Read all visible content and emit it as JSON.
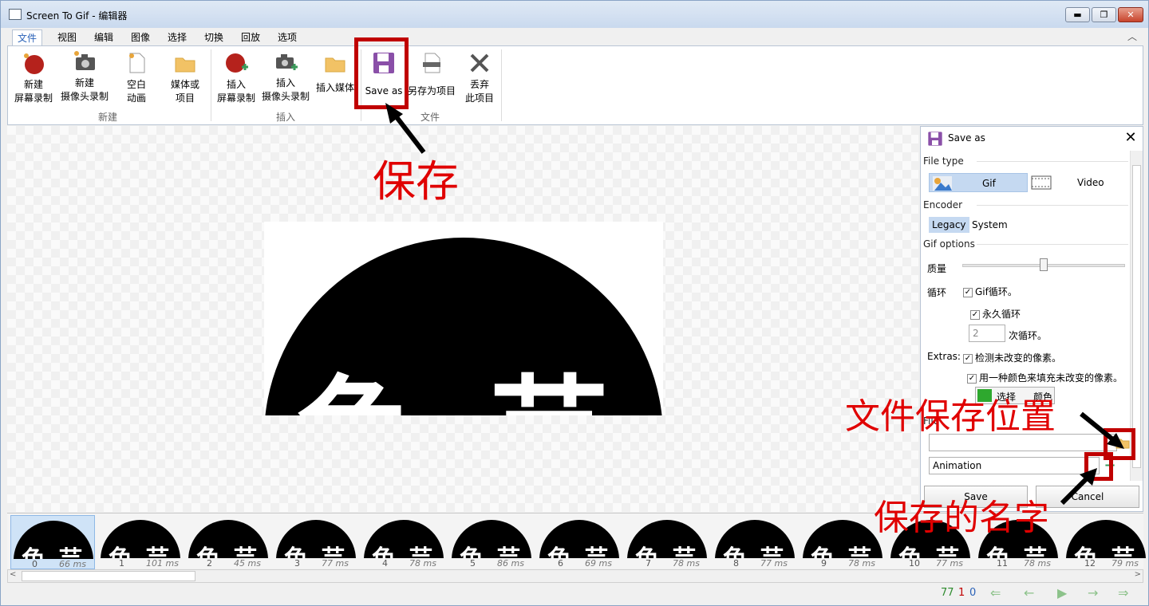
{
  "window": {
    "title": "Screen To Gif - 编辑器",
    "min": "▬",
    "max": "❐",
    "close": "✕"
  },
  "tabs": [
    "文件",
    "视图",
    "编辑",
    "图像",
    "选择",
    "切换",
    "回放",
    "选项"
  ],
  "ribbon": {
    "new_group": "新建",
    "insert_group": "插入",
    "file_group": "文件",
    "new_screen": [
      "新建",
      "屏幕录制"
    ],
    "new_webcam": [
      "新建",
      "摄像头录制"
    ],
    "blank": [
      "空白",
      "动画"
    ],
    "media": [
      "媒体或",
      "项目"
    ],
    "insert_screen": [
      "插入",
      "屏幕录制"
    ],
    "insert_webcam": [
      "插入",
      "摄像头录制"
    ],
    "insert_media": "插入媒体",
    "save_as": "Save as",
    "save_project": "另存为项目",
    "discard": [
      "丢弃",
      "此项目"
    ]
  },
  "canvas": {
    "glyphs": "色 芸"
  },
  "panel": {
    "title": "Save as",
    "file_type": "File type",
    "gif": "Gif",
    "video": "Video",
    "encoder": "Encoder",
    "legacy": "Legacy",
    "system": "System",
    "gif_options": "Gif options",
    "quality": "质量",
    "quality_level": 0.5,
    "loop": "循环",
    "gif_loop": "Gif循环。",
    "forever": "永久循环",
    "loop_count": "2",
    "loop_count_suffix": "次循环。",
    "extras": "Extras:",
    "detect": "检测未改变的像素。",
    "fill": "用一种颜色来填充未改变的像素。",
    "select_color": "选择",
    "select_color_tail": "颜色",
    "color_swatch": "#2ea82e",
    "file": "File",
    "folder_value": "",
    "filename": "Animation",
    "save": "Save",
    "cancel": "Cancel"
  },
  "frames": [
    {
      "n": "0",
      "ms": "66 ms"
    },
    {
      "n": "1",
      "ms": "101 ms"
    },
    {
      "n": "2",
      "ms": "45 ms"
    },
    {
      "n": "3",
      "ms": "77 ms"
    },
    {
      "n": "4",
      "ms": "78 ms"
    },
    {
      "n": "5",
      "ms": "86 ms"
    },
    {
      "n": "6",
      "ms": "69 ms"
    },
    {
      "n": "7",
      "ms": "78 ms"
    },
    {
      "n": "8",
      "ms": "77 ms"
    },
    {
      "n": "9",
      "ms": "78 ms"
    },
    {
      "n": "10",
      "ms": "77 ms"
    },
    {
      "n": "11",
      "ms": "78 ms"
    },
    {
      "n": "12",
      "ms": "79 ms"
    }
  ],
  "thumb_glyphs": "色 芸",
  "status": {
    "total": "77",
    "selected": "1",
    "current": "0"
  },
  "nav": {
    "first": "⇐",
    "prev": "←",
    "play": "▶",
    "next": "→",
    "last": "⇒"
  },
  "annotations": {
    "save": "保存",
    "location": "文件保存位置",
    "name": "保存的名字"
  },
  "colors": {
    "accent": "#2a62b8",
    "annotation": "#e00000",
    "frame_sel": "#cfe3f7"
  }
}
